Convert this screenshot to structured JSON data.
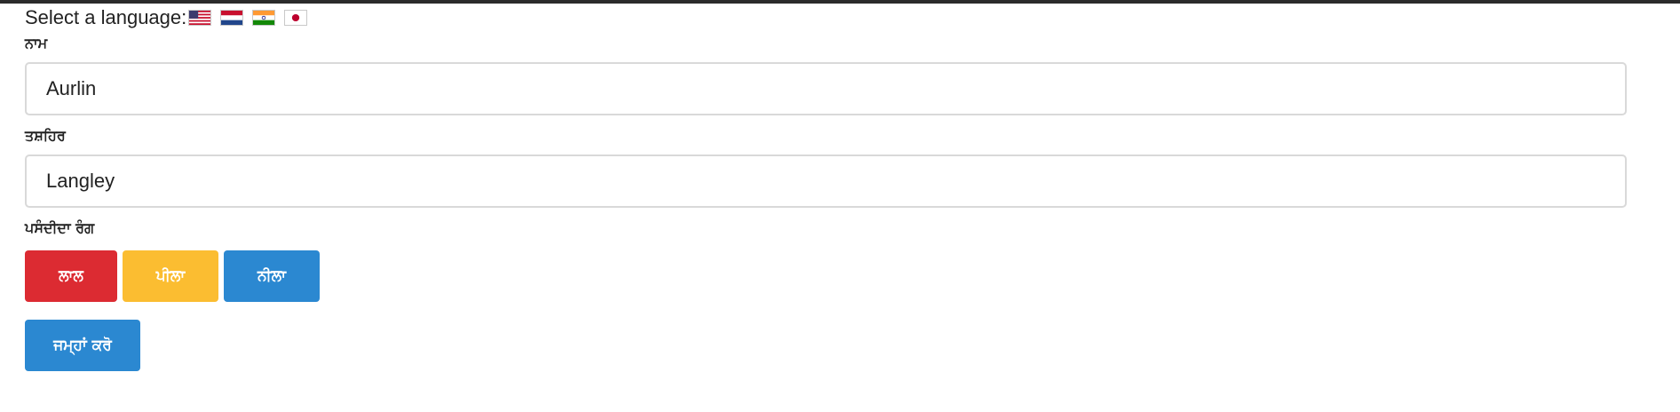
{
  "language_selector": {
    "label": "Select a language:",
    "flags": [
      {
        "icon": "us-flag-icon",
        "language": "English"
      },
      {
        "icon": "netherlands-flag-icon",
        "language": "Dutch"
      },
      {
        "icon": "india-flag-icon",
        "language": "Punjabi"
      },
      {
        "icon": "japan-flag-icon",
        "language": "Japanese"
      }
    ]
  },
  "form": {
    "name_label": "ਨਾਮ",
    "name_value": "Aurlin",
    "city_label": "ਤਸ਼ਹਿਰ",
    "city_value": "Langley",
    "color_label": "ਪਸੰਦੀਦਾ ਰੰਗ",
    "colors": {
      "red": "ਲਾਲ",
      "yellow": "ਪੀਲਾ",
      "blue": "ਨੀਲਾ"
    },
    "submit_label": "ਜਮ੍ਹਾਂ ਕਰੋ"
  },
  "theme": {
    "red": "#dc2b32",
    "yellow": "#fbbd31",
    "blue": "#2b88d1"
  }
}
